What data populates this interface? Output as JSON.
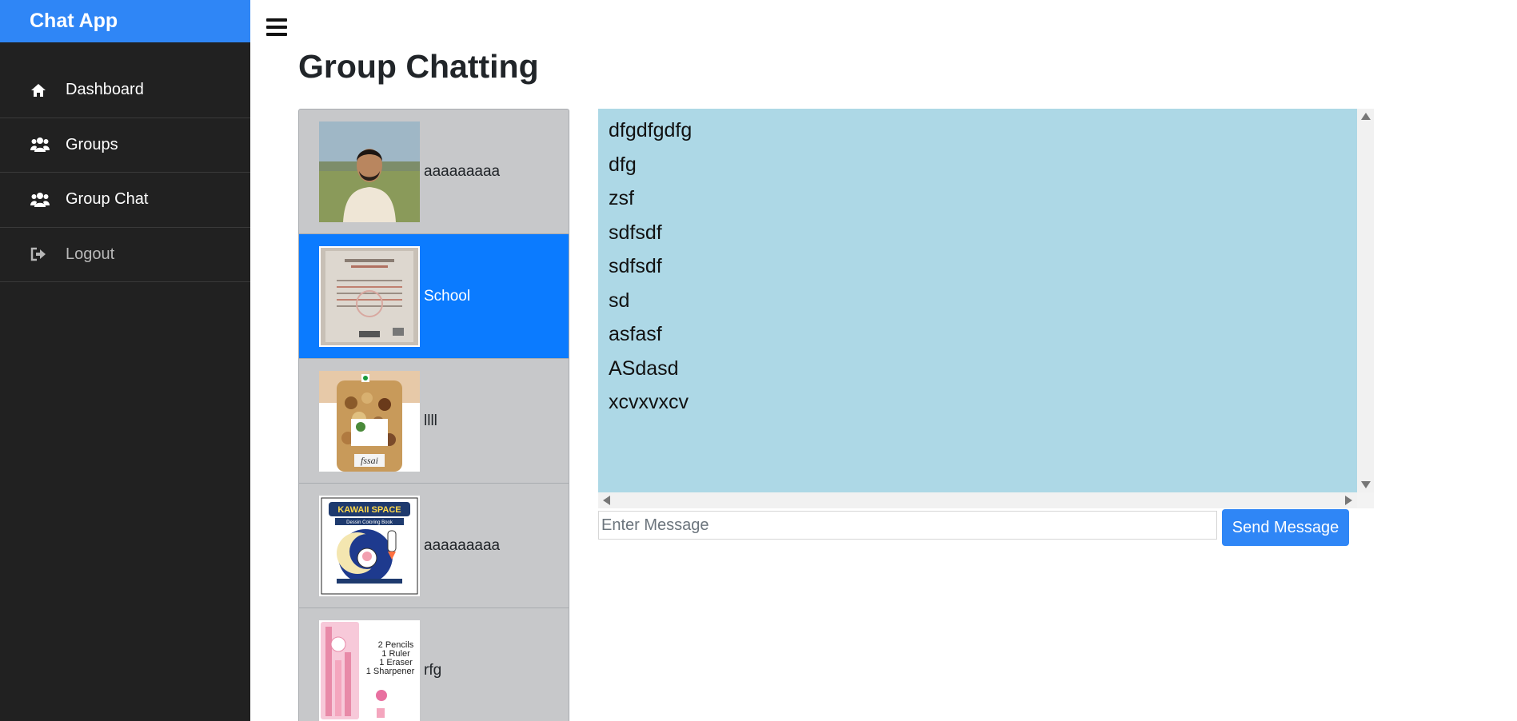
{
  "app": {
    "title": "Chat App"
  },
  "sidebar": {
    "items": [
      {
        "label": "Dashboard",
        "icon": "home-icon"
      },
      {
        "label": "Groups",
        "icon": "users-icon"
      },
      {
        "label": "Group Chat",
        "icon": "users-icon"
      },
      {
        "label": "Logout",
        "icon": "sign-out-icon"
      }
    ]
  },
  "page": {
    "title": "Group Chatting"
  },
  "groups": [
    {
      "name": "aaaaaaaaa",
      "image": "person-portrait"
    },
    {
      "name": "School",
      "image": "certificate-document",
      "active": true
    },
    {
      "name": "llll",
      "image": "dry-fruits-jar"
    },
    {
      "name": "aaaaaaaaa",
      "image": "kawaii-space-coloring-book"
    },
    {
      "name": "rfg",
      "image": "pencil-set"
    }
  ],
  "thumb_text": {
    "book_title": "KAWAII SPACE",
    "book_subtitle": "Dessin Coloring Book",
    "pencils": "2 Pencils",
    "ruler": "1 Ruler",
    "eraser": "1 Eraser",
    "sharpener": "1 Sharpener",
    "jar_label": "fssai"
  },
  "messages": [
    "dfgdfgdfg",
    "dfg",
    "zsf",
    "sdfsdf",
    "sdfsdf",
    "sd",
    "asfasf",
    "ASdasd",
    "xcvxvxcv"
  ],
  "composer": {
    "placeholder": "Enter Message",
    "send_label": "Send Message"
  },
  "colors": {
    "brand": "#2f86f6",
    "sidebar_bg": "#212121",
    "active_group": "#0b7bff",
    "chat_bg": "#add8e6",
    "group_bg": "#c7c8ca"
  }
}
